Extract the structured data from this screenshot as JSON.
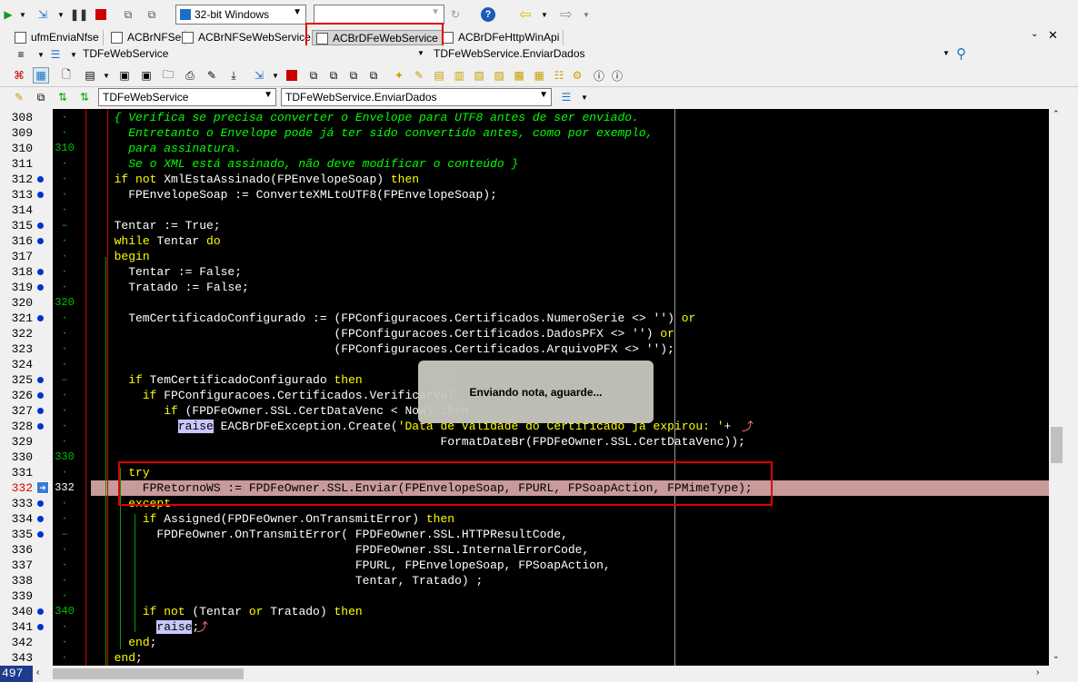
{
  "toolbar1": {
    "platform_combo": "32-bit Windows",
    "second_combo": ""
  },
  "tabs": [
    {
      "label": "ufmEnviaNfse"
    },
    {
      "label": "ACBrNFSe"
    },
    {
      "label": "ACBrNFSeWebService"
    },
    {
      "label": "ACBrDFeWebService",
      "active": true
    },
    {
      "label": "ACBrDFeHttpWinApi"
    }
  ],
  "toolbar2": {
    "class_combo": "TDFeWebService",
    "method_combo": "TDFeWebService.EnviarDados"
  },
  "toolbar4": {
    "class_select": "TDFeWebService",
    "method_select": "TDFeWebService.EnviarDados"
  },
  "popup": {
    "text": "Enviando nota, aguarde..."
  },
  "status": {
    "line_count": "497"
  },
  "current_line": "332",
  "lines": [
    {
      "n": "308",
      "mark": "·",
      "dot": false,
      "tokens": [
        {
          "t": "  { Verifica se precisa converter o Envelope para UTF8 antes de ser enviado.",
          "c": "cm"
        }
      ]
    },
    {
      "n": "309",
      "mark": "·",
      "dot": false,
      "tokens": [
        {
          "t": "    Entretanto o Envelope pode já ter sido convertido antes, como por exemplo,",
          "c": "cm"
        }
      ]
    },
    {
      "n": "310",
      "mark": "310",
      "dot": false,
      "tokens": [
        {
          "t": "    para assinatura.",
          "c": "cm"
        }
      ]
    },
    {
      "n": "311",
      "mark": "·",
      "dot": false,
      "tokens": [
        {
          "t": "    Se o XML está assinado, não deve modificar o conteúdo }",
          "c": "cm"
        }
      ]
    },
    {
      "n": "312",
      "mark": "·",
      "dot": true,
      "tokens": [
        {
          "t": "  "
        },
        {
          "t": "if not",
          "c": "kw"
        },
        {
          "t": " XmlEstaAssinado(FPEnvelopeSoap) "
        },
        {
          "t": "then",
          "c": "kw"
        }
      ]
    },
    {
      "n": "313",
      "mark": "·",
      "dot": true,
      "tokens": [
        {
          "t": "    FPEnvelopeSoap := ConverteXMLtoUTF8(FPEnvelopeSoap);"
        }
      ]
    },
    {
      "n": "314",
      "mark": "·",
      "dot": false,
      "tokens": [
        {
          "t": ""
        }
      ]
    },
    {
      "n": "315",
      "mark": "–",
      "dot": true,
      "tokens": [
        {
          "t": "  Tentar := True;"
        }
      ]
    },
    {
      "n": "316",
      "mark": "·",
      "dot": true,
      "tokens": [
        {
          "t": "  "
        },
        {
          "t": "while",
          "c": "kw"
        },
        {
          "t": " Tentar "
        },
        {
          "t": "do",
          "c": "kw"
        }
      ]
    },
    {
      "n": "317",
      "mark": "·",
      "dot": false,
      "tokens": [
        {
          "t": "  "
        },
        {
          "t": "begin",
          "c": "kw"
        }
      ]
    },
    {
      "n": "318",
      "mark": "·",
      "dot": true,
      "tokens": [
        {
          "t": "    Tentar := False;"
        }
      ]
    },
    {
      "n": "319",
      "mark": "·",
      "dot": true,
      "tokens": [
        {
          "t": "    Tratado := False;"
        }
      ]
    },
    {
      "n": "320",
      "mark": "320",
      "dot": false,
      "tokens": [
        {
          "t": ""
        }
      ]
    },
    {
      "n": "321",
      "mark": "·",
      "dot": true,
      "tokens": [
        {
          "t": "    TemCertificadoConfigurado := (FPConfiguracoes.Certificados.NumeroSerie <> '') "
        },
        {
          "t": "or",
          "c": "kw"
        }
      ]
    },
    {
      "n": "322",
      "mark": "·",
      "dot": false,
      "tokens": [
        {
          "t": "                                 (FPConfiguracoes.Certificados.DadosPFX <> '') "
        },
        {
          "t": "or",
          "c": "kw"
        }
      ]
    },
    {
      "n": "323",
      "mark": "·",
      "dot": false,
      "tokens": [
        {
          "t": "                                 (FPConfiguracoes.Certificados.ArquivoPFX <> '');"
        }
      ]
    },
    {
      "n": "324",
      "mark": "·",
      "dot": false,
      "tokens": [
        {
          "t": ""
        }
      ]
    },
    {
      "n": "325",
      "mark": "–",
      "dot": true,
      "tokens": [
        {
          "t": "    "
        },
        {
          "t": "if",
          "c": "kw"
        },
        {
          "t": " TemCertificadoConfigurado "
        },
        {
          "t": "then",
          "c": "kw"
        }
      ]
    },
    {
      "n": "326",
      "mark": "·",
      "dot": true,
      "tokens": [
        {
          "t": "      "
        },
        {
          "t": "if",
          "c": "kw"
        },
        {
          "t": " FPConfiguracoes.Certificados.VerificarVal"
        }
      ]
    },
    {
      "n": "327",
      "mark": "·",
      "dot": true,
      "tokens": [
        {
          "t": "         "
        },
        {
          "t": "if",
          "c": "kw"
        },
        {
          "t": " (FPDFeOwner.SSL.CertDataVenc < Now) "
        },
        {
          "t": "then",
          "c": "kw"
        }
      ]
    },
    {
      "n": "328",
      "mark": "·",
      "dot": true,
      "tokens": [
        {
          "t": "           "
        },
        {
          "t": "raise",
          "c": "hl"
        },
        {
          "t": " EACBrDFeException.Create("
        },
        {
          "t": "'Data de Validade do Certificado já expirou: '",
          "c": "st"
        },
        {
          "t": "+"
        }
      ]
    },
    {
      "n": "329",
      "mark": "·",
      "dot": false,
      "tokens": [
        {
          "t": "                                                FormatDateBr(FPDFeOwner.SSL.CertDataVenc));"
        }
      ]
    },
    {
      "n": "330",
      "mark": "330",
      "dot": false,
      "tokens": [
        {
          "t": ""
        }
      ]
    },
    {
      "n": "331",
      "mark": "·",
      "dot": false,
      "tokens": [
        {
          "t": "    "
        },
        {
          "t": "try",
          "c": "kw"
        }
      ]
    },
    {
      "n": "332",
      "mark": "332",
      "dot": false,
      "cur": true,
      "tokens": [
        {
          "t": "      FPRetornoWS := FPDFeOwner.SSL.Enviar(FPEnvelopeSoap, FPURL, FPSoapAction, FPMimeType);"
        }
      ]
    },
    {
      "n": "333",
      "mark": "·",
      "dot": true,
      "tokens": [
        {
          "t": "    "
        },
        {
          "t": "except",
          "c": "kw"
        }
      ]
    },
    {
      "n": "334",
      "mark": "·",
      "dot": true,
      "tokens": [
        {
          "t": "      "
        },
        {
          "t": "if",
          "c": "kw"
        },
        {
          "t": " Assigned(FPDFeOwner.OnTransmitError) "
        },
        {
          "t": "then",
          "c": "kw"
        }
      ]
    },
    {
      "n": "335",
      "mark": "–",
      "dot": true,
      "tokens": [
        {
          "t": "        FPDFeOwner.OnTransmitError( FPDFeOwner.SSL.HTTPResultCode,"
        }
      ]
    },
    {
      "n": "336",
      "mark": "·",
      "dot": false,
      "tokens": [
        {
          "t": "                                    FPDFeOwner.SSL.InternalErrorCode,"
        }
      ]
    },
    {
      "n": "337",
      "mark": "·",
      "dot": false,
      "tokens": [
        {
          "t": "                                    FPURL, FPEnvelopeSoap, FPSoapAction,"
        }
      ]
    },
    {
      "n": "338",
      "mark": "·",
      "dot": false,
      "tokens": [
        {
          "t": "                                    Tentar, Tratado) ;"
        }
      ]
    },
    {
      "n": "339",
      "mark": "·",
      "dot": false,
      "tokens": [
        {
          "t": ""
        }
      ]
    },
    {
      "n": "340",
      "mark": "340",
      "dot": true,
      "tokens": [
        {
          "t": "      "
        },
        {
          "t": "if not",
          "c": "kw"
        },
        {
          "t": " (Tentar "
        },
        {
          "t": "or",
          "c": "kw"
        },
        {
          "t": " Tratado) "
        },
        {
          "t": "then",
          "c": "kw"
        }
      ]
    },
    {
      "n": "341",
      "mark": "·",
      "dot": true,
      "tokens": [
        {
          "t": "        "
        },
        {
          "t": "raise",
          "c": "hl"
        },
        {
          "t": ";"
        }
      ]
    },
    {
      "n": "342",
      "mark": "·",
      "dot": false,
      "tokens": [
        {
          "t": "    "
        },
        {
          "t": "end",
          "c": "kw"
        },
        {
          "t": ";"
        }
      ]
    },
    {
      "n": "343",
      "mark": "·",
      "dot": false,
      "tokens": [
        {
          "t": "  "
        },
        {
          "t": "end",
          "c": "kw"
        },
        {
          "t": ";"
        }
      ]
    }
  ]
}
